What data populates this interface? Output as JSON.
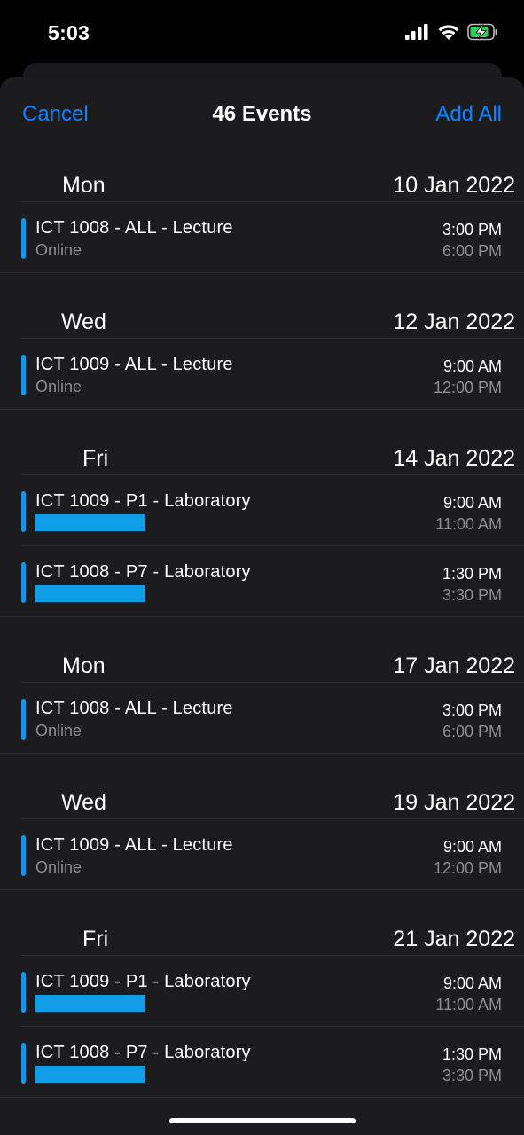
{
  "status_bar": {
    "time": "5:03"
  },
  "nav": {
    "cancel": "Cancel",
    "title": "46 Events",
    "add_all": "Add All"
  },
  "days": [
    {
      "day": "Mon",
      "date": "10 Jan 2022",
      "events": [
        {
          "title": "ICT 1008 - ALL - Lecture",
          "location": "Online",
          "start": "3:00 PM",
          "end": "6:00 PM"
        }
      ]
    },
    {
      "day": "Wed",
      "date": "12 Jan 2022",
      "events": [
        {
          "title": "ICT 1009 - ALL - Lecture",
          "location": "Online",
          "start": "9:00 AM",
          "end": "12:00 PM"
        }
      ]
    },
    {
      "day": "Fri",
      "date": "14 Jan 2022",
      "events": [
        {
          "title": "ICT 1009 - P1 - Laboratory",
          "location": "",
          "start": "9:00 AM",
          "end": "11:00 AM"
        },
        {
          "title": "ICT 1008 - P7 - Laboratory",
          "location": "",
          "start": "1:30 PM",
          "end": "3:30 PM"
        }
      ]
    },
    {
      "day": "Mon",
      "date": "17 Jan 2022",
      "events": [
        {
          "title": "ICT 1008 - ALL - Lecture",
          "location": "Online",
          "start": "3:00 PM",
          "end": "6:00 PM"
        }
      ]
    },
    {
      "day": "Wed",
      "date": "19 Jan 2022",
      "events": [
        {
          "title": "ICT 1009 - ALL - Lecture",
          "location": "Online",
          "start": "9:00 AM",
          "end": "12:00 PM"
        }
      ]
    },
    {
      "day": "Fri",
      "date": "21 Jan 2022",
      "events": [
        {
          "title": "ICT 1009 - P1 - Laboratory",
          "location": "",
          "start": "9:00 AM",
          "end": "11:00 AM"
        },
        {
          "title": "ICT 1008 - P7 - Laboratory",
          "location": "",
          "start": "1:30 PM",
          "end": "3:30 PM"
        }
      ]
    },
    {
      "day": "Mon",
      "date": "24 Jan 2022",
      "events": []
    }
  ],
  "colors": {
    "accent": "#0a84ff",
    "event_bar": "#1497e8",
    "redaction": "#0f9de8"
  }
}
